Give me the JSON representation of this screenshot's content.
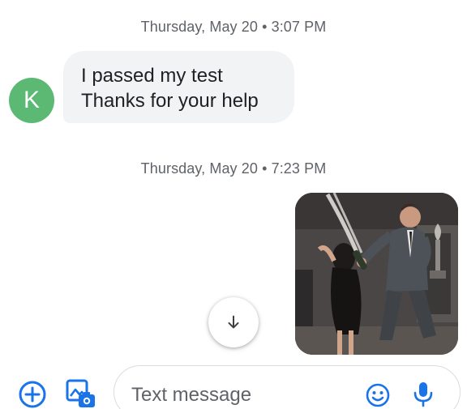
{
  "conversation": {
    "timestamps": [
      "Thursday, May 20 • 3:07 PM",
      "Thursday, May 20 • 7:23 PM"
    ],
    "incoming": {
      "avatar_letter": "K",
      "avatar_color": "#5bb974",
      "lines": [
        "I passed my test",
        "Thanks for your help"
      ]
    },
    "outgoing": {
      "media_icon": "celebration-gif-image"
    }
  },
  "scroll_button": {
    "icon": "arrow-down-icon"
  },
  "compose": {
    "placeholder": "Text message",
    "add_icon": "add-circle-icon",
    "gallery_icon": "photo-gallery-icon",
    "emoji_icon": "emoji-icon",
    "mic_icon": "microphone-icon"
  },
  "colors": {
    "accent": "#1a73e8",
    "incoming_bubble": "#f1f3f4",
    "text": "#202124",
    "secondary_text": "#5f6368"
  }
}
